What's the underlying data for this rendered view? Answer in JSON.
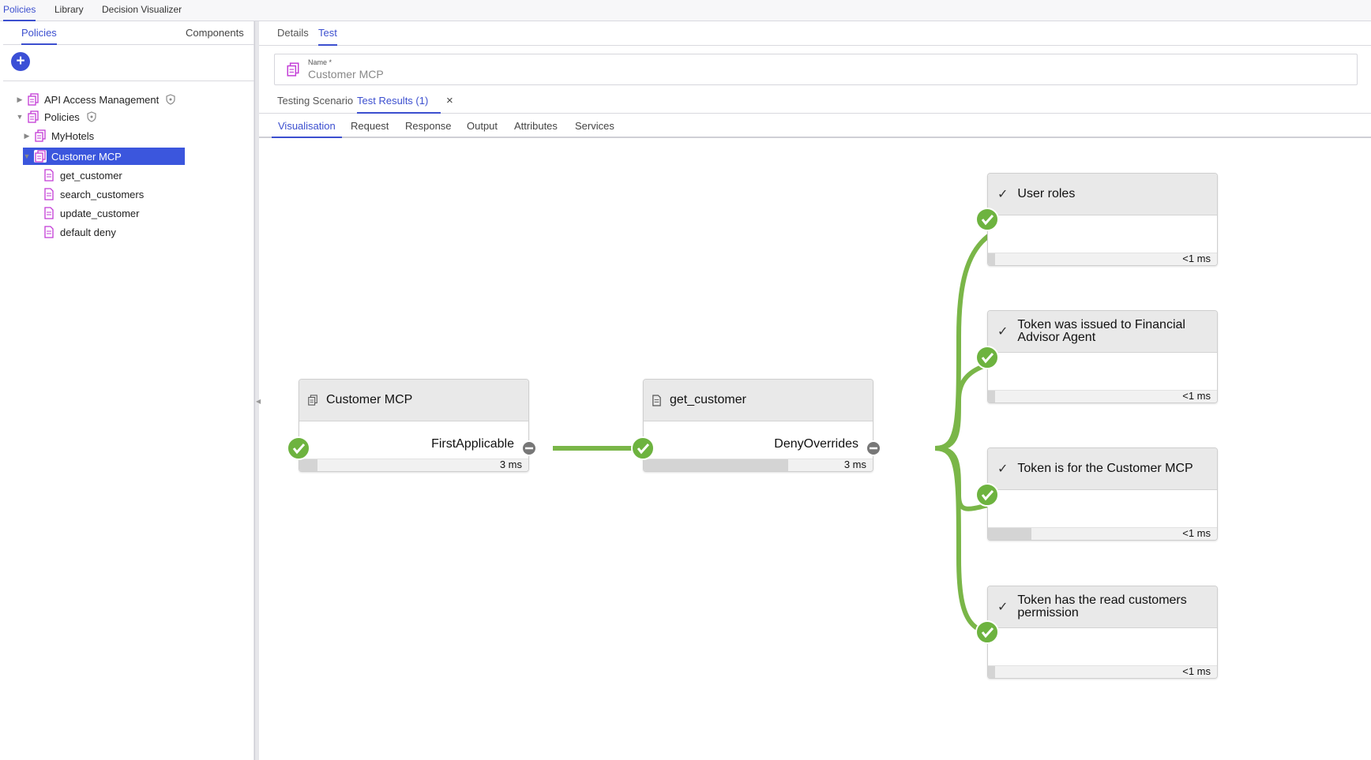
{
  "topnav": {
    "items": [
      "Policies",
      "Library",
      "Decision Visualizer"
    ],
    "active": "Policies"
  },
  "left_panel": {
    "tabs": [
      "Policies",
      "Components"
    ],
    "add_button": "+",
    "tree": [
      {
        "label": "API Access Management",
        "expanded": false,
        "type": "policy-set",
        "shield": true
      },
      {
        "label": "Policies",
        "expanded": true,
        "type": "policy-set",
        "shield": true
      },
      {
        "label": "MyHotels",
        "expanded": false,
        "type": "policy-set"
      },
      {
        "label": "Customer MCP",
        "expanded": true,
        "type": "policy-set",
        "selected": true
      },
      {
        "label": "get_customer",
        "type": "rule"
      },
      {
        "label": "search_customers",
        "type": "rule"
      },
      {
        "label": "update_customer",
        "type": "rule"
      },
      {
        "label": "default deny",
        "type": "rule"
      }
    ]
  },
  "main": {
    "tabs": [
      "Details",
      "Test"
    ],
    "active_tab": "Test",
    "name_field": {
      "label": "Name",
      "required_mark": "*",
      "value": "Customer MCP"
    },
    "sub_tabs": [
      "Testing Scenario",
      "Test Results (1)"
    ],
    "close_icon": "×",
    "vis_tabs": [
      "Visualisation",
      "Request",
      "Response",
      "Output",
      "Attributes",
      "Services"
    ]
  },
  "diagram": {
    "colors": {
      "edge": "#7ab648",
      "ok": "#6db33f",
      "neutral": "#777777"
    },
    "nodes": [
      {
        "id": "customer-mcp",
        "title": "Customer MCP",
        "combiner": "FirstApplicable",
        "time": "3 ms",
        "fill": 0.08,
        "icon": "policy-set-icon"
      },
      {
        "id": "get-customer",
        "title": "get_customer",
        "combiner": "DenyOverrides",
        "time": "3 ms",
        "fill": 0.63,
        "icon": "policy-doc-icon"
      }
    ],
    "rules": [
      {
        "title": "User roles",
        "time": "<1 ms",
        "fill": 0.03
      },
      {
        "title": "Token was issued to Financial Advisor Agent",
        "time": "<1 ms",
        "fill": 0.03
      },
      {
        "title": "Token is for the Customer MCP",
        "time": "<1 ms",
        "fill": 0.19
      },
      {
        "title": "Token has the read customers permission",
        "time": "<1 ms",
        "fill": 0.03
      }
    ]
  }
}
